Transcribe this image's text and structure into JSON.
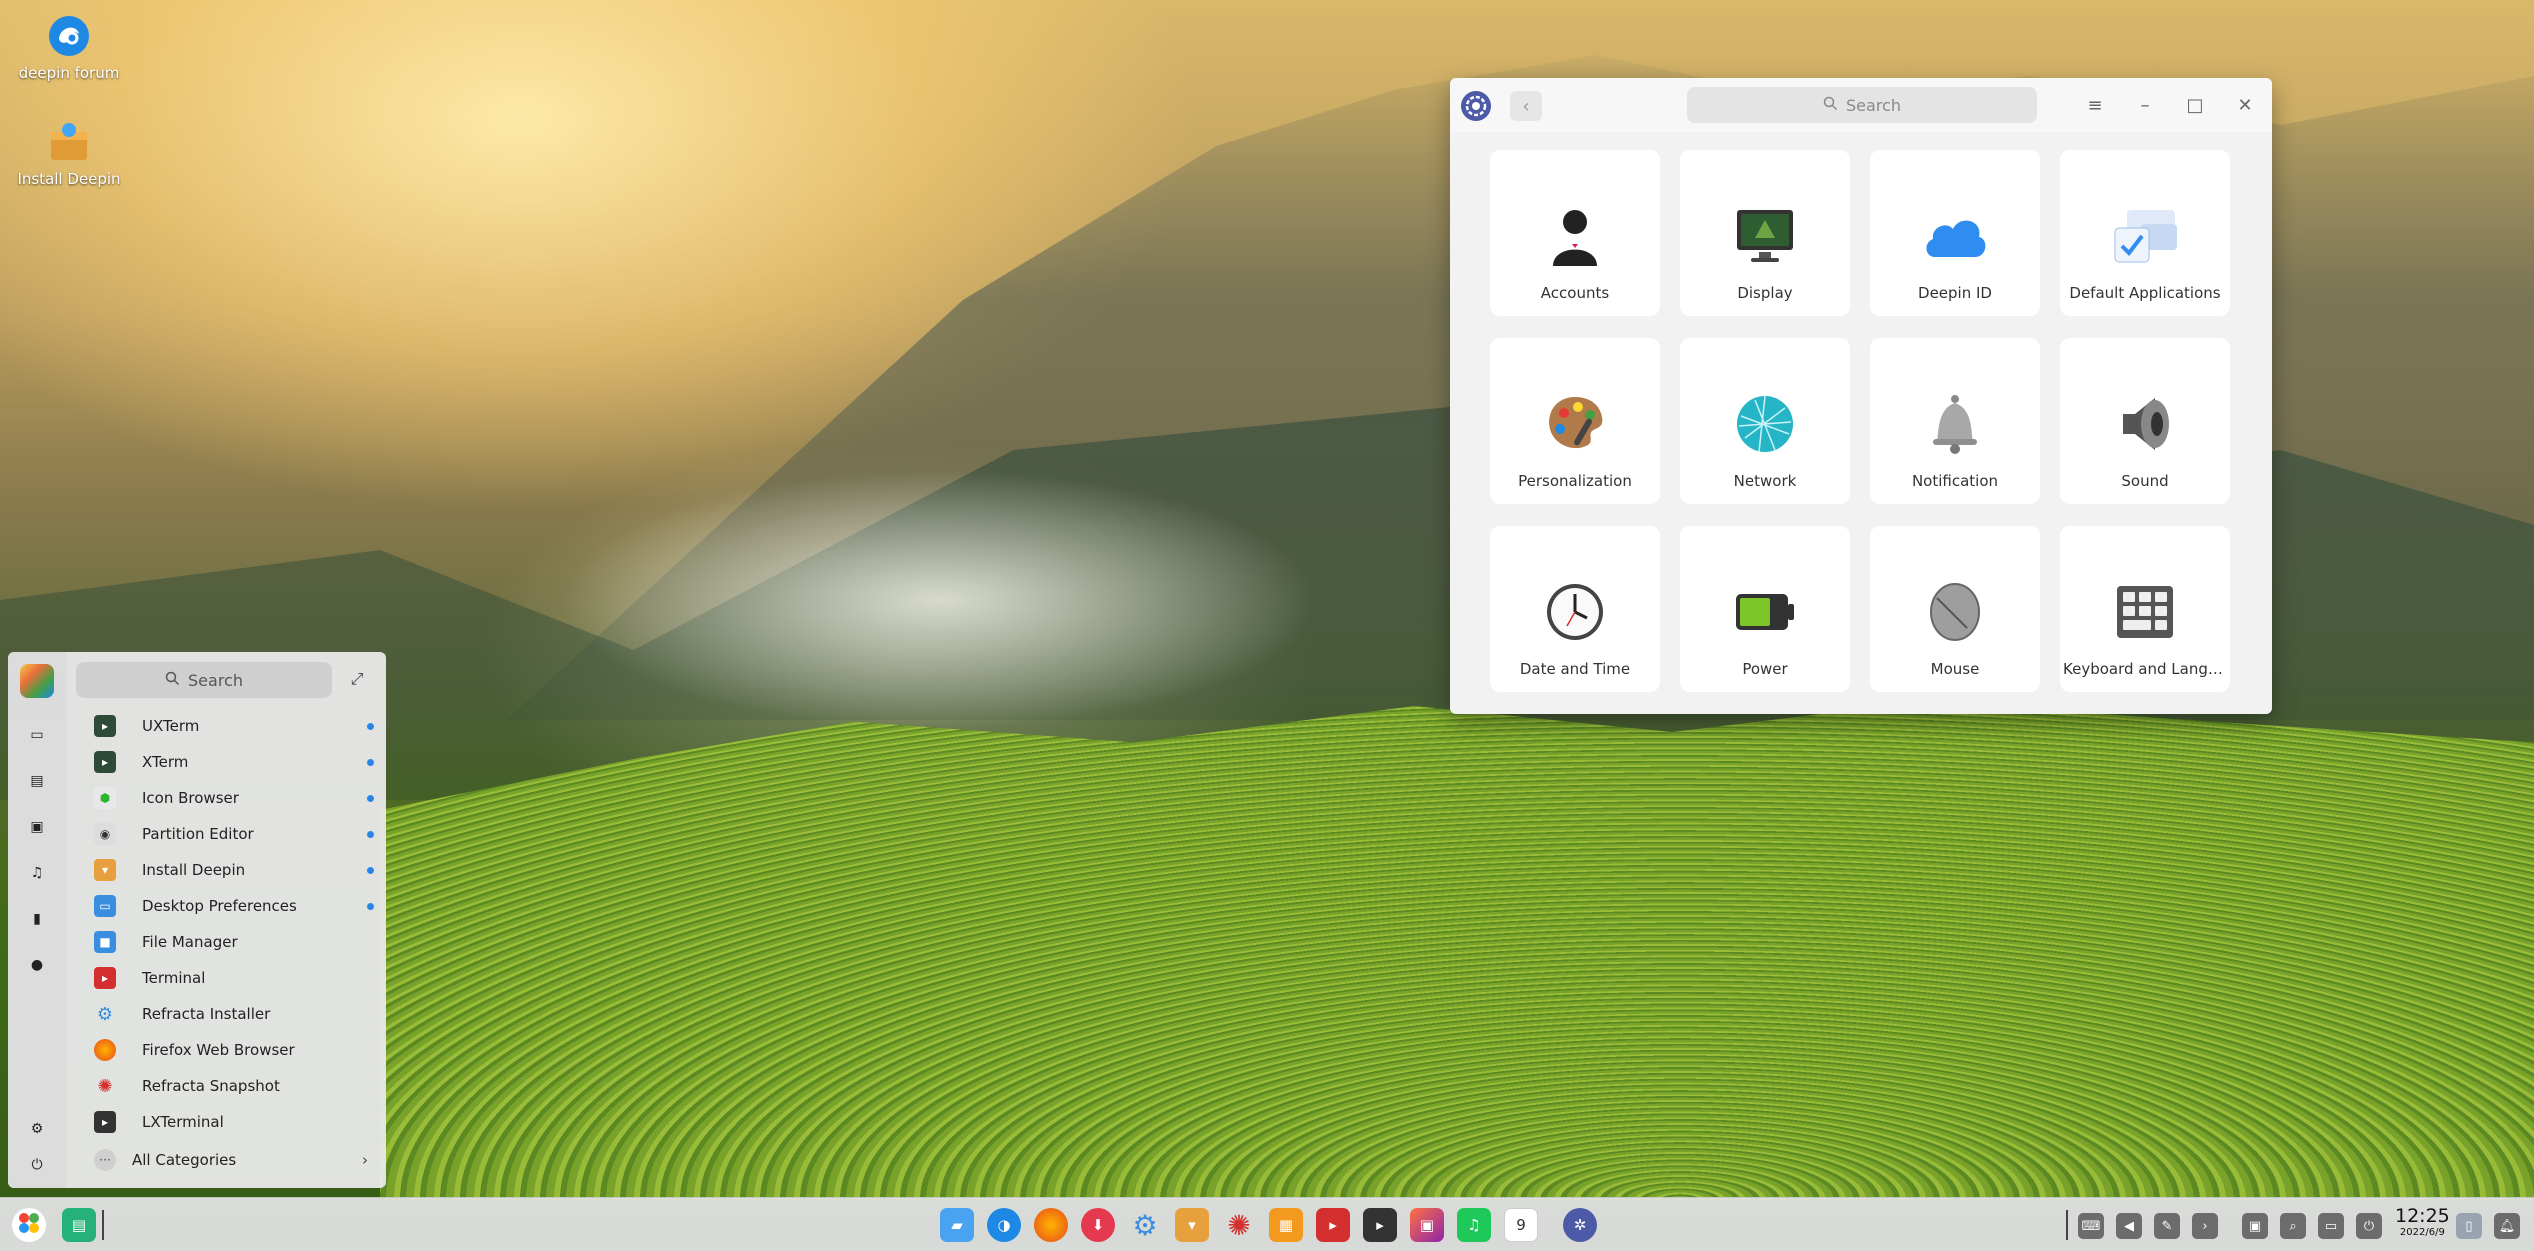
{
  "desktop": {
    "icons": [
      {
        "label": "deepin forum",
        "icon": "deepin-forum-icon"
      },
      {
        "label": "Install Deepin",
        "icon": "install-deepin-icon"
      }
    ]
  },
  "control_center": {
    "search_placeholder": "Search",
    "back_icon": "chevron-left-icon",
    "menu_icon": "hamburger-menu-icon",
    "tiles": [
      {
        "label": "Accounts",
        "icon": "accounts-icon"
      },
      {
        "label": "Display",
        "icon": "display-icon"
      },
      {
        "label": "Deepin ID",
        "icon": "cloud-icon"
      },
      {
        "label": "Default Applications",
        "icon": "default-apps-icon"
      },
      {
        "label": "Personalization",
        "icon": "palette-icon"
      },
      {
        "label": "Network",
        "icon": "network-globe-icon"
      },
      {
        "label": "Notification",
        "icon": "bell-icon"
      },
      {
        "label": "Sound",
        "icon": "speaker-icon"
      },
      {
        "label": "Date and Time",
        "icon": "clock-icon"
      },
      {
        "label": "Power",
        "icon": "battery-icon"
      },
      {
        "label": "Mouse",
        "icon": "mouse-icon"
      },
      {
        "label": "Keyboard and Langua...",
        "icon": "keyboard-icon"
      }
    ]
  },
  "launcher": {
    "search_placeholder": "Search",
    "items": [
      {
        "label": "UXTerm",
        "new": true
      },
      {
        "label": "XTerm",
        "new": true
      },
      {
        "label": "Icon Browser",
        "new": true
      },
      {
        "label": "Partition Editor",
        "new": true
      },
      {
        "label": "Install Deepin",
        "new": true
      },
      {
        "label": "Desktop Preferences",
        "new": true
      },
      {
        "label": "File Manager",
        "new": false
      },
      {
        "label": "Terminal",
        "new": false
      },
      {
        "label": "Refracta Installer",
        "new": false
      },
      {
        "label": "Firefox Web Browser",
        "new": false
      },
      {
        "label": "Refracta Snapshot",
        "new": false
      },
      {
        "label": "LXTerminal",
        "new": false
      }
    ],
    "all_categories": "All Categories"
  },
  "dock": {
    "calendar_day": "9",
    "clock_time": "12:25",
    "clock_date": "2022/6/9"
  },
  "colors": {
    "accent": "#2b84e8",
    "window_bg": "#f2f2f2",
    "tile_bg": "#ffffff"
  }
}
